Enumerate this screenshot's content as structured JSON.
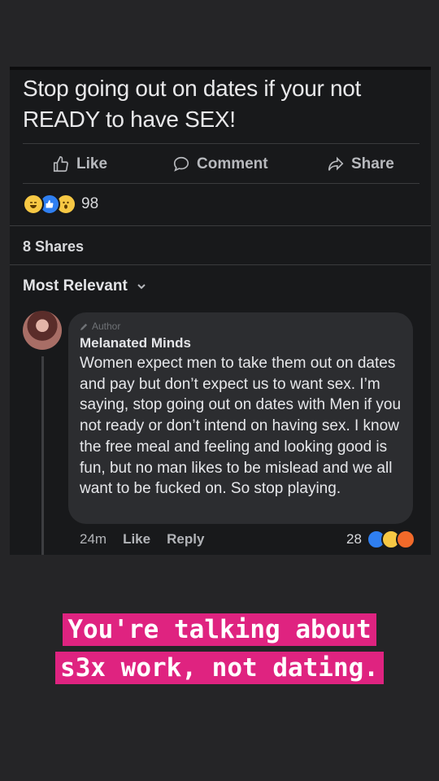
{
  "post": {
    "text": "Stop going out on dates if your not READY to have SEX!",
    "actions": {
      "like": "Like",
      "comment": "Comment",
      "share": "Share"
    },
    "reaction_count": "98",
    "shares": "8 Shares",
    "sort_label": "Most Relevant"
  },
  "comment": {
    "author_tag": "Author",
    "name": "Melanated Minds",
    "text": "Women expect men to take them out on dates and pay but don’t expect us to want sex. I’m saying, stop going out on dates with Men if you not ready or don’t intend on having sex. I know the free meal and feeling and looking good is fun, but no man likes to be mislead and we all want to be fucked on. So stop playing.",
    "time": "24m",
    "like": "Like",
    "reply": "Reply",
    "reaction_count": "28"
  },
  "caption": {
    "line1": "You're talking about",
    "line2": "s3x work, not dating."
  },
  "colors": {
    "caption_bg": "#df2380",
    "like_blue": "#2f7ff1",
    "haha_yellow": "#f7c844",
    "angry_orange": "#f16a2a"
  },
  "icons": [
    "thumbs-up-icon",
    "comment-bubble-icon",
    "share-arrow-icon",
    "chevron-down-icon",
    "pencil-icon"
  ]
}
